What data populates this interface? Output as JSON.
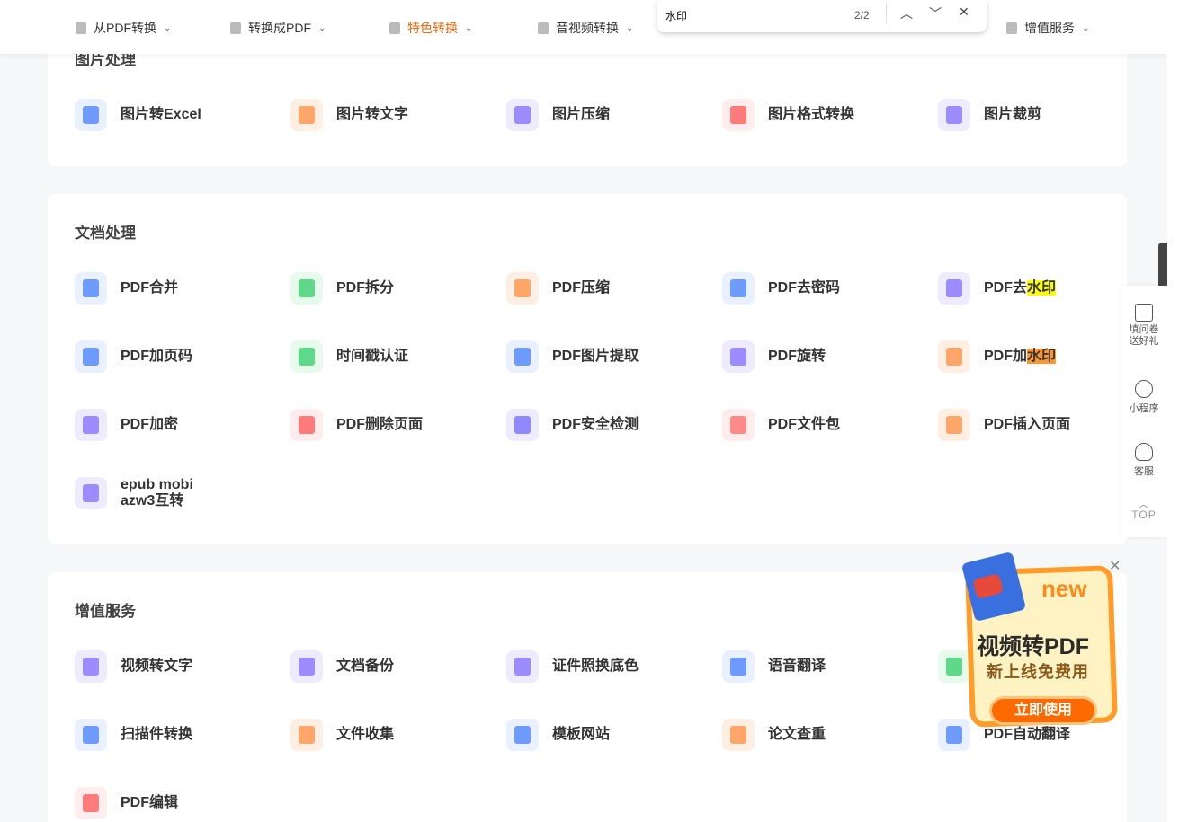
{
  "nav": [
    {
      "label": "从PDF转换",
      "active": false
    },
    {
      "label": "转换成PDF",
      "active": false
    },
    {
      "label": "特色转换",
      "active": true
    },
    {
      "label": "音视频转换",
      "active": false
    },
    {
      "label": "增值服务",
      "active": false
    }
  ],
  "find": {
    "query": "水印",
    "count": "2/2",
    "prev": "︿",
    "next": "﹀",
    "close": "✕"
  },
  "sections": [
    {
      "title": "图片处理",
      "items": [
        {
          "label": "图片转Excel",
          "icon": "image-excel-icon",
          "color": "#6f9bff",
          "bg": "#e9f0ff"
        },
        {
          "label": "图片转文字",
          "icon": "image-text-icon",
          "color": "#ffa66b",
          "bg": "#ffeee2"
        },
        {
          "label": "图片压缩",
          "icon": "image-compress-icon",
          "color": "#9b8cff",
          "bg": "#eeebff"
        },
        {
          "label": "图片格式转换",
          "icon": "image-format-icon",
          "color": "#ff7a7a",
          "bg": "#ffecec"
        },
        {
          "label": "图片裁剪",
          "icon": "image-crop-icon",
          "color": "#9b8cff",
          "bg": "#eeebff"
        }
      ]
    },
    {
      "title": "文档处理",
      "items": [
        {
          "label": "PDF合并",
          "icon": "pdf-merge-icon",
          "color": "#6f9bff",
          "bg": "#e9f0ff"
        },
        {
          "label": "PDF拆分",
          "icon": "pdf-split-icon",
          "color": "#5fd88a",
          "bg": "#e6fbec"
        },
        {
          "label": "PDF压缩",
          "icon": "pdf-compress-icon",
          "color": "#ffa66b",
          "bg": "#ffeee2"
        },
        {
          "label": "PDF去密码",
          "icon": "pdf-unlock-icon",
          "color": "#6f9bff",
          "bg": "#e9f0ff"
        },
        {
          "label": "PDF去",
          "highlight": "水印",
          "current": false,
          "icon": "pdf-remove-watermark-icon",
          "color": "#9b8cff",
          "bg": "#eeebff"
        },
        {
          "label": "PDF加页码",
          "icon": "pdf-page-number-icon",
          "color": "#6f9bff",
          "bg": "#e9f0ff"
        },
        {
          "label": "时间戳认证",
          "icon": "timestamp-icon",
          "color": "#5fd88a",
          "bg": "#e6fbec"
        },
        {
          "label": "PDF图片提取",
          "icon": "pdf-image-extract-icon",
          "color": "#6f9bff",
          "bg": "#e9f0ff"
        },
        {
          "label": "PDF旋转",
          "icon": "pdf-rotate-icon",
          "color": "#9b8cff",
          "bg": "#eeebff"
        },
        {
          "label": "PDF加",
          "highlight": "水印",
          "current": true,
          "icon": "pdf-add-watermark-icon",
          "color": "#ffa66b",
          "bg": "#ffeee2"
        },
        {
          "label": "PDF加密",
          "icon": "pdf-encrypt-icon",
          "color": "#9b8cff",
          "bg": "#eeebff"
        },
        {
          "label": "PDF删除页面",
          "icon": "pdf-delete-page-icon",
          "color": "#ff7a7a",
          "bg": "#ffecec"
        },
        {
          "label": "PDF安全检测",
          "icon": "pdf-security-icon",
          "color": "#8f88ff",
          "bg": "#eeebff"
        },
        {
          "label": "PDF文件包",
          "icon": "pdf-package-icon",
          "color": "#ff8a8a",
          "bg": "#ffecec"
        },
        {
          "label": "PDF插入页面",
          "icon": "pdf-insert-page-icon",
          "color": "#ffa66b",
          "bg": "#ffeee2"
        },
        {
          "label": "epub mobi\nazw3互转",
          "icon": "ebook-convert-icon",
          "color": "#9b8cff",
          "bg": "#eeebff"
        }
      ]
    },
    {
      "title": "增值服务",
      "items": [
        {
          "label": "视频转文字",
          "icon": "video-text-icon",
          "color": "#9b8cff",
          "bg": "#eeebff"
        },
        {
          "label": "文档备份",
          "icon": "doc-backup-icon",
          "color": "#9b8cff",
          "bg": "#eeebff"
        },
        {
          "label": "证件照换底色",
          "icon": "id-photo-icon",
          "color": "#9b8cff",
          "bg": "#eeebff"
        },
        {
          "label": "语音翻译",
          "icon": "voice-translate-icon",
          "color": "#6f9bff",
          "bg": "#e9f0ff"
        },
        {
          "label": "",
          "icon": "audio-text-icon",
          "color": "#5fd88a",
          "bg": "#e6fbec"
        },
        {
          "label": "扫描件转换",
          "icon": "scan-convert-icon",
          "color": "#6f9bff",
          "bg": "#e9f0ff"
        },
        {
          "label": "文件收集",
          "icon": "file-collect-icon",
          "color": "#ffa66b",
          "bg": "#ffeee2"
        },
        {
          "label": "模板网站",
          "icon": "cloud-template-icon",
          "color": "#6f9bff",
          "bg": "#e9f0ff"
        },
        {
          "label": "论文查重",
          "icon": "paper-check-icon",
          "color": "#ffa66b",
          "bg": "#ffeee2"
        },
        {
          "label": "PDF自动翻译",
          "icon": "pdf-translate-icon",
          "color": "#6f9bff",
          "bg": "#e9f0ff"
        },
        {
          "label": "PDF编辑",
          "icon": "pdf-edit-icon",
          "color": "#ff7a7a",
          "bg": "#ffecec"
        }
      ]
    }
  ],
  "sidebar": {
    "survey": "填问卷\n送好礼",
    "miniprogram": "小程序",
    "service": "客服",
    "top": "TOP"
  },
  "ad": {
    "badge": "new",
    "title": "视频转PDF",
    "subtitle": "新上线免费用",
    "button": "立即使用"
  }
}
